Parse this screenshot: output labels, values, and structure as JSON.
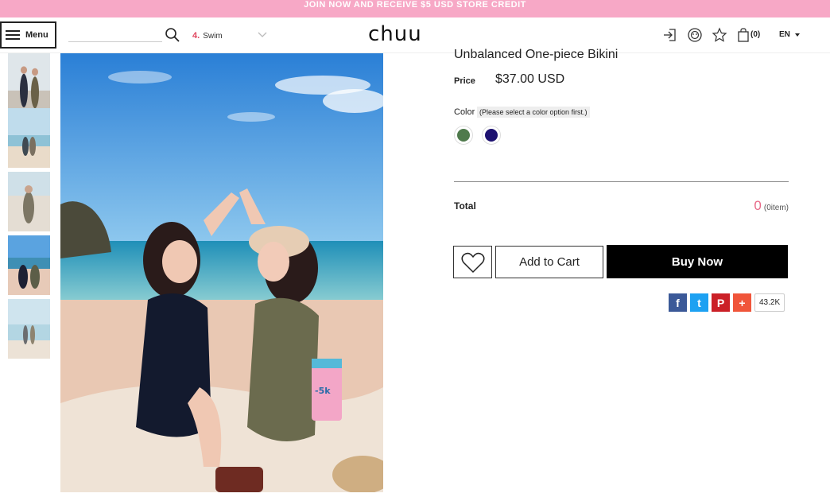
{
  "promo": {
    "text": "JOIN NOW AND RECEIVE $5 USD STORE CREDIT",
    "bg": "#f7a8c6"
  },
  "header": {
    "menu_label": "Menu",
    "search_placeholder": "",
    "category_num": "4.",
    "category_name": "Swim",
    "logo": "chuu",
    "cart_count": "(0)",
    "language": "EN"
  },
  "product": {
    "title": "Unbalanced One-piece Bikini",
    "price_label": "Price",
    "price": "$37.00 USD",
    "color_label": "Color",
    "color_note": "(Please select a color option first.)",
    "colors": [
      "#4f7a4c",
      "#1d1170"
    ],
    "total_label": "Total",
    "total_count": "0",
    "total_unit": "(0item)",
    "add_to_cart": "Add to Cart",
    "buy_now": "Buy Now"
  },
  "share": {
    "facebook": "f",
    "twitter": "t",
    "pinterest": "P",
    "more": "+",
    "count": "43.2K",
    "colors": {
      "facebook": "#3b5998",
      "twitter": "#1da1f2",
      "pinterest": "#cb2027",
      "more": "#f0553a"
    }
  },
  "icons": [
    "menu-icon",
    "search-icon",
    "chevron-down-icon",
    "login-icon",
    "chat-icon",
    "star-icon",
    "bag-icon",
    "heart-icon"
  ]
}
